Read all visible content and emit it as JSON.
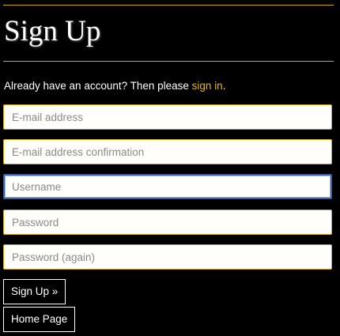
{
  "page": {
    "title": "Sign Up",
    "signin_prefix": "Already have an account? Then please ",
    "signin_link": "sign in",
    "signin_suffix": "."
  },
  "form": {
    "email_placeholder": "E-mail address",
    "email_confirm_placeholder": "E-mail address confirmation",
    "username_placeholder": "Username",
    "password_placeholder": "Password",
    "password_again_placeholder": "Password (again)"
  },
  "buttons": {
    "signup_label": "Sign Up »",
    "homepage_label": "Home Page"
  },
  "colors": {
    "background": "#000000",
    "accent": "#c9a227",
    "link": "#e0b33a",
    "focus": "#3a5fa8"
  }
}
